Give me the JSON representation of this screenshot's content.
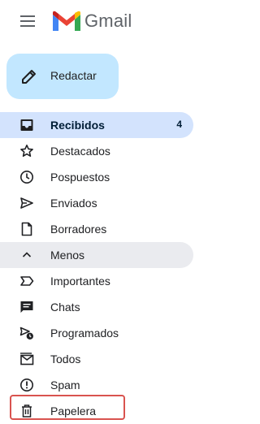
{
  "app": {
    "logo_text": "Gmail"
  },
  "compose": {
    "label": "Redactar"
  },
  "nav": {
    "items": [
      {
        "label": "Recibidos",
        "count": "4",
        "icon": "inbox-icon"
      },
      {
        "label": "Destacados",
        "icon": "star-icon"
      },
      {
        "label": "Pospuestos",
        "icon": "clock-icon"
      },
      {
        "label": "Enviados",
        "icon": "send-icon"
      },
      {
        "label": "Borradores",
        "icon": "draft-icon"
      },
      {
        "label": "Menos",
        "icon": "chevron-up-icon"
      },
      {
        "label": "Importantes",
        "icon": "label-important-icon"
      },
      {
        "label": "Chats",
        "icon": "chat-icon"
      },
      {
        "label": "Programados",
        "icon": "scheduled-send-icon"
      },
      {
        "label": "Todos",
        "icon": "all-mail-icon"
      },
      {
        "label": "Spam",
        "icon": "report-icon"
      },
      {
        "label": "Papelera",
        "icon": "trash-icon"
      }
    ]
  },
  "colors": {
    "active_bg": "#d3e3fd",
    "compose_bg": "#c2e7ff",
    "highlight": "#d9534f"
  }
}
